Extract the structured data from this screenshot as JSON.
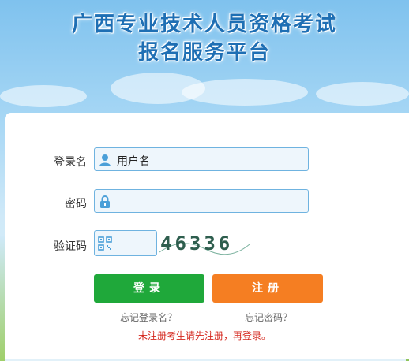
{
  "header": {
    "title_line1": "广西专业技术人员资格考试",
    "title_line2": "报名服务平台"
  },
  "form": {
    "username": {
      "label": "登录名",
      "value": "用户名",
      "icon": "user-icon"
    },
    "password": {
      "label": "密码",
      "value": "",
      "icon": "lock-icon"
    },
    "captcha": {
      "label": "验证码",
      "value": "",
      "icon": "qr-icon",
      "code": "46336"
    }
  },
  "buttons": {
    "login": "登录",
    "register": "注册"
  },
  "links": {
    "forgot_username": "忘记登录名？",
    "forgot_password": "忘记密码？"
  },
  "notice": "未注册考生请先注册，再登录。",
  "colors": {
    "title": "#1e6fb4",
    "login_button": "#1fa83a",
    "register_button": "#f57e22",
    "notice": "#d4261c",
    "input_border": "#6fb3e0"
  }
}
